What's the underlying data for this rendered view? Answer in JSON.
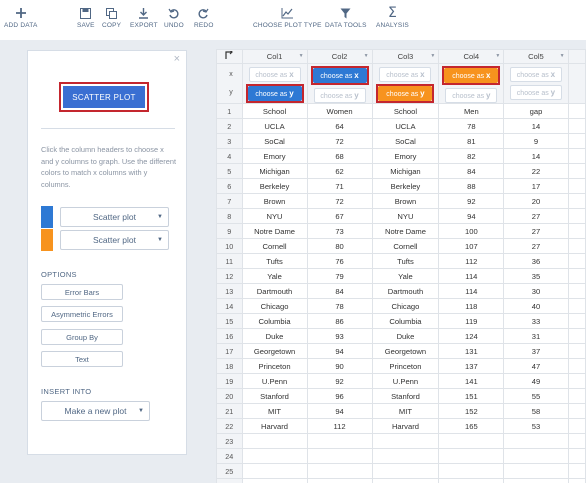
{
  "toolbar": {
    "add_data": "ADD DATA",
    "save": "SAVE",
    "copy": "COPY",
    "export": "EXPORT",
    "undo": "UNDO",
    "redo": "REDO",
    "choose_plot_type": "CHOOSE PLOT TYPE",
    "data_tools": "DATA TOOLS",
    "analysis": "ANALYSIS"
  },
  "panel": {
    "close": "×",
    "scatter_button": "SCATTER PLOT",
    "help_text": "Click the column headers to choose x and y columns to graph. Use the different colors to match x columns with y columns.",
    "trace1": {
      "label": "Scatter plot",
      "color": "#2e79d4"
    },
    "trace2": {
      "label": "Scatter plot",
      "color": "#f7931e"
    },
    "options_title": "OPTIONS",
    "options": [
      "Error Bars",
      "Asymmetric Errors",
      "Group By",
      "Text"
    ],
    "insert_title": "INSERT INTO",
    "insert_value": "Make a new plot"
  },
  "grid": {
    "x_label": "x",
    "y_label": "y",
    "placeholder_x": "choose as x",
    "placeholder_y": "choose as y",
    "columns": [
      "Col1",
      "Col2",
      "Col3",
      "Col4",
      "Col5"
    ],
    "assignments": [
      {
        "x": "",
        "y": "blue"
      },
      {
        "x": "blue",
        "y": ""
      },
      {
        "x": "",
        "y": "orange"
      },
      {
        "x": "orange",
        "y": ""
      },
      {
        "x": "",
        "y": ""
      }
    ],
    "rows": [
      [
        "School",
        "Women",
        "School",
        "Men",
        "gap"
      ],
      [
        "UCLA",
        "64",
        "UCLA",
        "78",
        "14"
      ],
      [
        "SoCal",
        "72",
        "SoCal",
        "81",
        "9"
      ],
      [
        "Emory",
        "68",
        "Emory",
        "82",
        "14"
      ],
      [
        "Michigan",
        "62",
        "Michigan",
        "84",
        "22"
      ],
      [
        "Berkeley",
        "71",
        "Berkeley",
        "88",
        "17"
      ],
      [
        "Brown",
        "72",
        "Brown",
        "92",
        "20"
      ],
      [
        "NYU",
        "67",
        "NYU",
        "94",
        "27"
      ],
      [
        "Notre Dame",
        "73",
        "Notre Dame",
        "100",
        "27"
      ],
      [
        "Cornell",
        "80",
        "Cornell",
        "107",
        "27"
      ],
      [
        "Tufts",
        "76",
        "Tufts",
        "112",
        "36"
      ],
      [
        "Yale",
        "79",
        "Yale",
        "114",
        "35"
      ],
      [
        "Dartmouth",
        "84",
        "Dartmouth",
        "114",
        "30"
      ],
      [
        "Chicago",
        "78",
        "Chicago",
        "118",
        "40"
      ],
      [
        "Columbia",
        "86",
        "Columbia",
        "119",
        "33"
      ],
      [
        "Duke",
        "93",
        "Duke",
        "124",
        "31"
      ],
      [
        "Georgetown",
        "94",
        "Georgetown",
        "131",
        "37"
      ],
      [
        "Princeton",
        "90",
        "Princeton",
        "137",
        "47"
      ],
      [
        "U.Penn",
        "92",
        "U.Penn",
        "141",
        "49"
      ],
      [
        "Stanford",
        "96",
        "Stanford",
        "151",
        "55"
      ],
      [
        "MIT",
        "94",
        "MIT",
        "152",
        "58"
      ],
      [
        "Harvard",
        "112",
        "Harvard",
        "165",
        "53"
      ],
      [
        "",
        "",
        "",
        "",
        ""
      ],
      [
        "",
        "",
        "",
        "",
        ""
      ],
      [
        "",
        "",
        "",
        "",
        ""
      ],
      [
        "",
        "",
        "",
        "",
        ""
      ]
    ]
  }
}
